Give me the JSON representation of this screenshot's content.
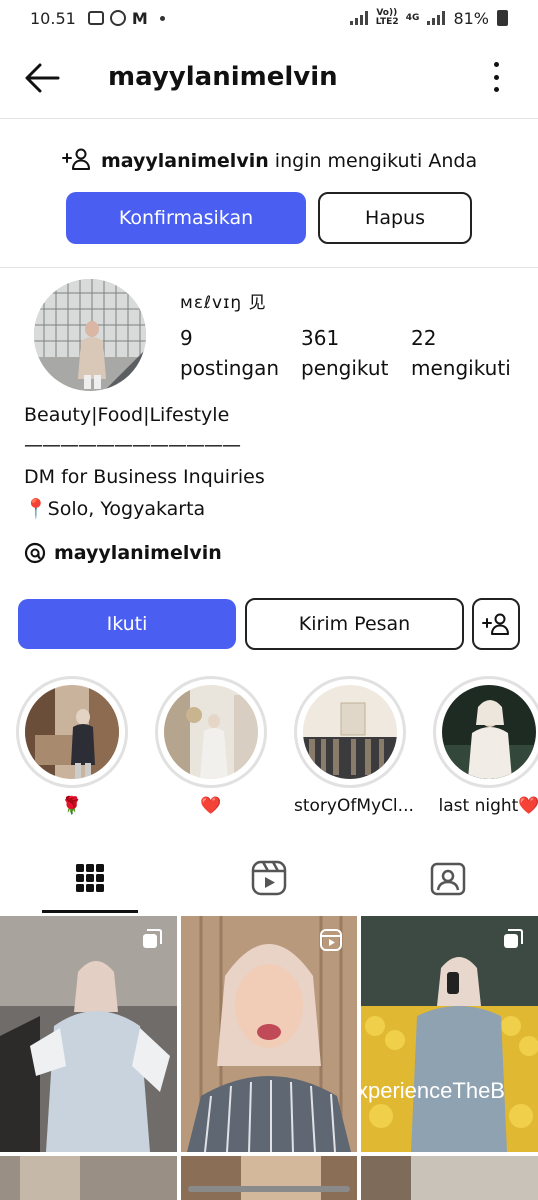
{
  "status_bar": {
    "time": "10.51",
    "network": "4G",
    "lte_label": "Vo)) LTE2",
    "battery": "81%"
  },
  "header": {
    "username": "mayylanimelvin"
  },
  "follow_request": {
    "username": "mayylanimelvin",
    "message": "ingin mengikuti Anda",
    "confirm_label": "Konfirmasikan",
    "delete_label": "Hapus"
  },
  "profile": {
    "display_name": "ᴍɛℓᴠɪŋ ⻅",
    "stats": [
      {
        "value": "9",
        "label": "postingan"
      },
      {
        "value": "361",
        "label": "pengikut"
      },
      {
        "value": "22",
        "label": "mengikuti"
      }
    ],
    "bio": [
      "Beauty|Food|Lifestyle",
      "————————————",
      "DM for Business Inquiries",
      "📍Solo, Yogyakarta"
    ],
    "threads_handle": "mayylanimelvin"
  },
  "actions": {
    "follow_label": "Ikuti",
    "message_label": "Kirim Pesan"
  },
  "highlights": [
    {
      "label": "🌹"
    },
    {
      "label": "❤️"
    },
    {
      "label": "storyOfMyCl..."
    },
    {
      "label": "last night❤️"
    }
  ],
  "post_overlay_text": "xperienceTheB",
  "colors": {
    "accent": "#4a5ff2",
    "divider": "#e3e3e3",
    "story_ring": "#e1e1e1"
  },
  "icons": {
    "back": "arrow-left-icon",
    "more": "kebab-icon",
    "add_person": "person-add-icon",
    "threads": "threads-icon",
    "grid_tab": "grid-icon",
    "reels_tab": "reels-icon",
    "tagged_tab": "tagged-icon"
  }
}
